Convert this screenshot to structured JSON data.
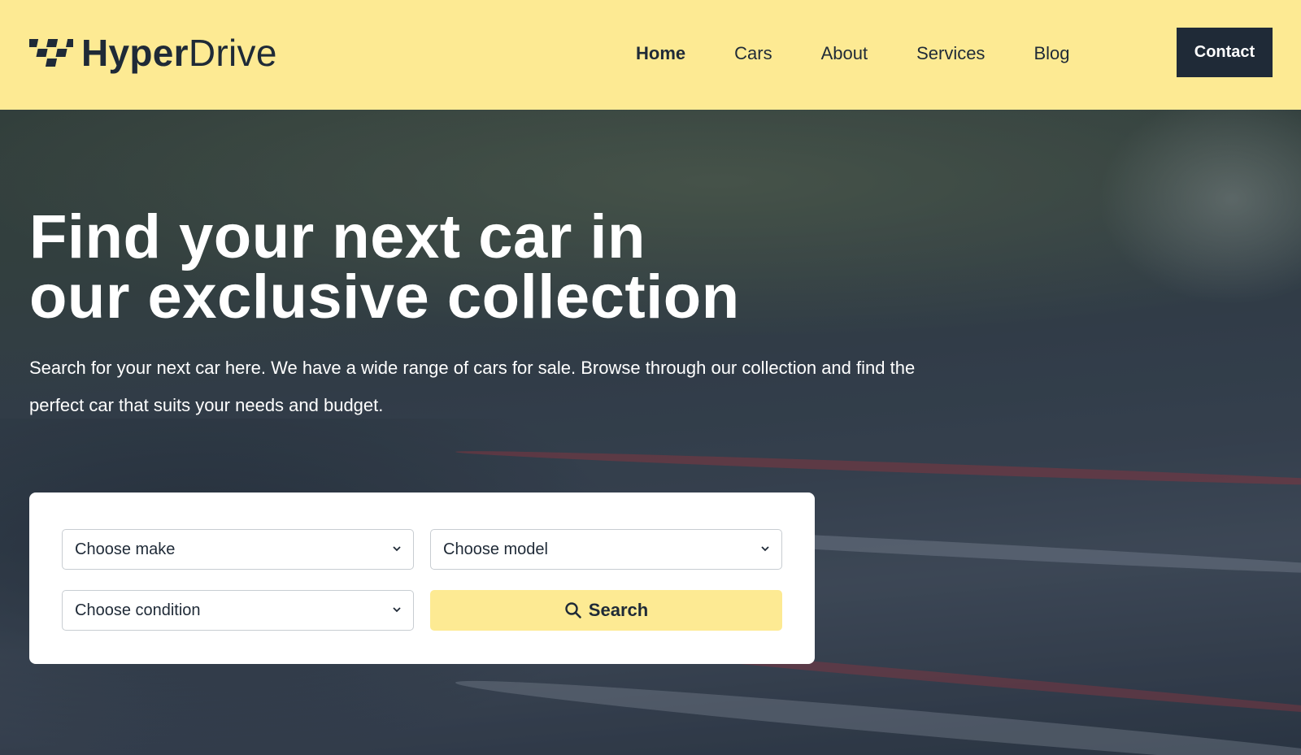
{
  "brand": {
    "name_bold": "Hyper",
    "name_light": "Drive"
  },
  "nav": {
    "items": [
      {
        "label": "Home",
        "active": true
      },
      {
        "label": "Cars",
        "active": false
      },
      {
        "label": "About",
        "active": false
      },
      {
        "label": "Services",
        "active": false
      },
      {
        "label": "Blog",
        "active": false
      }
    ],
    "contact_label": "Contact"
  },
  "hero": {
    "title_line1": "Find your next car in",
    "title_line2": "our exclusive collection",
    "subtitle": "Search for your next car here. We have a wide range of cars for sale. Browse through our collection and find the perfect car that suits your needs and budget."
  },
  "search": {
    "make_placeholder": "Choose make",
    "model_placeholder": "Choose model",
    "condition_placeholder": "Choose condition",
    "button_label": "Search",
    "button_icon": "search-icon"
  },
  "colors": {
    "accent_yellow": "#fdea93",
    "dark_navy": "#1f2a37",
    "white": "#ffffff"
  }
}
